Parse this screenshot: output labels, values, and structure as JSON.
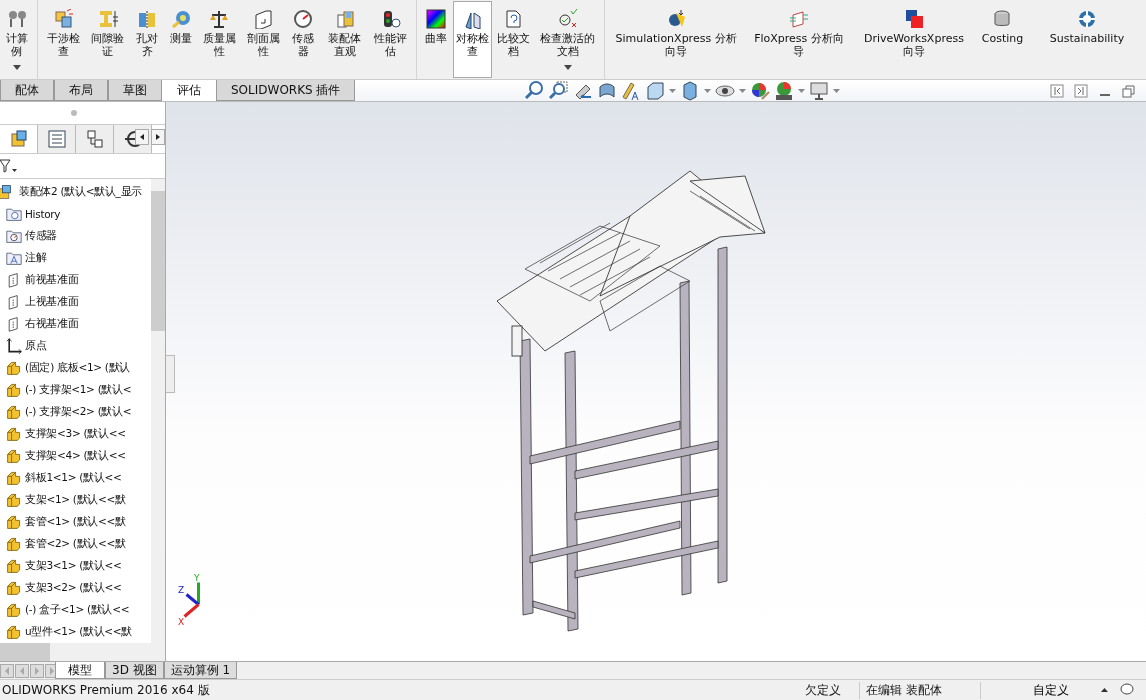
{
  "ribbon": {
    "groups": [
      {
        "items": [
          {
            "label": "计算例",
            "selected": false,
            "has_menu": true
          }
        ]
      },
      {
        "items": [
          {
            "label": "干涉检查",
            "selected": false,
            "has_menu": false
          },
          {
            "label": "间隙验证",
            "selected": false,
            "has_menu": false
          },
          {
            "label": "孔对齐",
            "selected": false,
            "has_menu": false
          },
          {
            "label": "测量",
            "selected": false,
            "has_menu": false
          },
          {
            "label": "质量属性",
            "selected": false,
            "has_menu": false
          },
          {
            "label": "剖面属性",
            "selected": false,
            "has_menu": false
          },
          {
            "label": "传感器",
            "selected": false,
            "has_menu": false
          },
          {
            "label": "装配体直观",
            "selected": false,
            "has_menu": false
          },
          {
            "label": "性能评估",
            "selected": false,
            "has_menu": false
          }
        ]
      },
      {
        "items": [
          {
            "label": "曲率",
            "selected": false,
            "has_menu": false
          },
          {
            "label": "对称检查",
            "selected": true,
            "has_menu": false
          },
          {
            "label": "比较文档",
            "selected": false,
            "has_menu": false
          },
          {
            "label": "检查激活的文档",
            "selected": false,
            "has_menu": true
          }
        ]
      },
      {
        "items": [
          {
            "label": "SimulationXpress 分析向导",
            "selected": false,
            "has_menu": false
          },
          {
            "label": "FloXpress 分析向导",
            "selected": false,
            "has_menu": false
          },
          {
            "label": "DriveWorksXpress 向导",
            "selected": false,
            "has_menu": false
          },
          {
            "label": "Costing",
            "selected": false,
            "has_menu": false
          },
          {
            "label": "Sustainability",
            "selected": false,
            "has_menu": false
          }
        ]
      }
    ]
  },
  "tabs": [
    {
      "label": "配体",
      "selected": false
    },
    {
      "label": "布局",
      "selected": false
    },
    {
      "label": "草图",
      "selected": false
    },
    {
      "label": "评估",
      "selected": true
    },
    {
      "label": "SOLIDWORKS 插件",
      "selected": false
    }
  ],
  "panel_tabs": [
    {
      "selected": true
    },
    {
      "selected": false
    },
    {
      "selected": false
    },
    {
      "selected": false
    }
  ],
  "feature_tree": {
    "root": {
      "label": "装配体2 (默认<默认_显示",
      "children": [
        {
          "kind": "history",
          "label": "History"
        },
        {
          "kind": "sensor",
          "label": "传感器"
        },
        {
          "kind": "annotation",
          "label": "注解"
        },
        {
          "kind": "plane",
          "label": "前视基准面"
        },
        {
          "kind": "plane",
          "label": "上视基准面"
        },
        {
          "kind": "plane",
          "label": "右视基准面"
        },
        {
          "kind": "origin",
          "label": "原点"
        },
        {
          "kind": "part",
          "label": "(固定) 底板<1> (默认"
        },
        {
          "kind": "part",
          "label": "(-) 支撑架<1> (默认<"
        },
        {
          "kind": "part",
          "label": "(-) 支撑架<2> (默认<"
        },
        {
          "kind": "part",
          "label": "支撑架<3> (默认<<"
        },
        {
          "kind": "part",
          "label": "支撑架<4> (默认<<"
        },
        {
          "kind": "part",
          "label": "斜板1<1> (默认<<"
        },
        {
          "kind": "part",
          "label": "支架<1> (默认<<默"
        },
        {
          "kind": "part",
          "label": "套管<1> (默认<<默"
        },
        {
          "kind": "part",
          "label": "套管<2> (默认<<默"
        },
        {
          "kind": "part",
          "label": "支架3<1> (默认<<"
        },
        {
          "kind": "part",
          "label": "支架3<2> (默认<<"
        },
        {
          "kind": "part",
          "label": "(-) 盒子<1> (默认<<"
        },
        {
          "kind": "part",
          "label": "u型件<1> (默认<<默"
        }
      ]
    }
  },
  "triad": {
    "x": "X",
    "y": "Y",
    "z": "Z"
  },
  "bottom_tabs": [
    {
      "label": "模型",
      "selected": true
    },
    {
      "label": "3D 视图",
      "selected": false
    },
    {
      "label": "运动算例 1",
      "selected": false
    }
  ],
  "status_bar": {
    "product": "OLIDWORKS Premium 2016 x64 版",
    "definition": "欠定义",
    "mode": "在编辑 装配体",
    "units": "自定义"
  }
}
